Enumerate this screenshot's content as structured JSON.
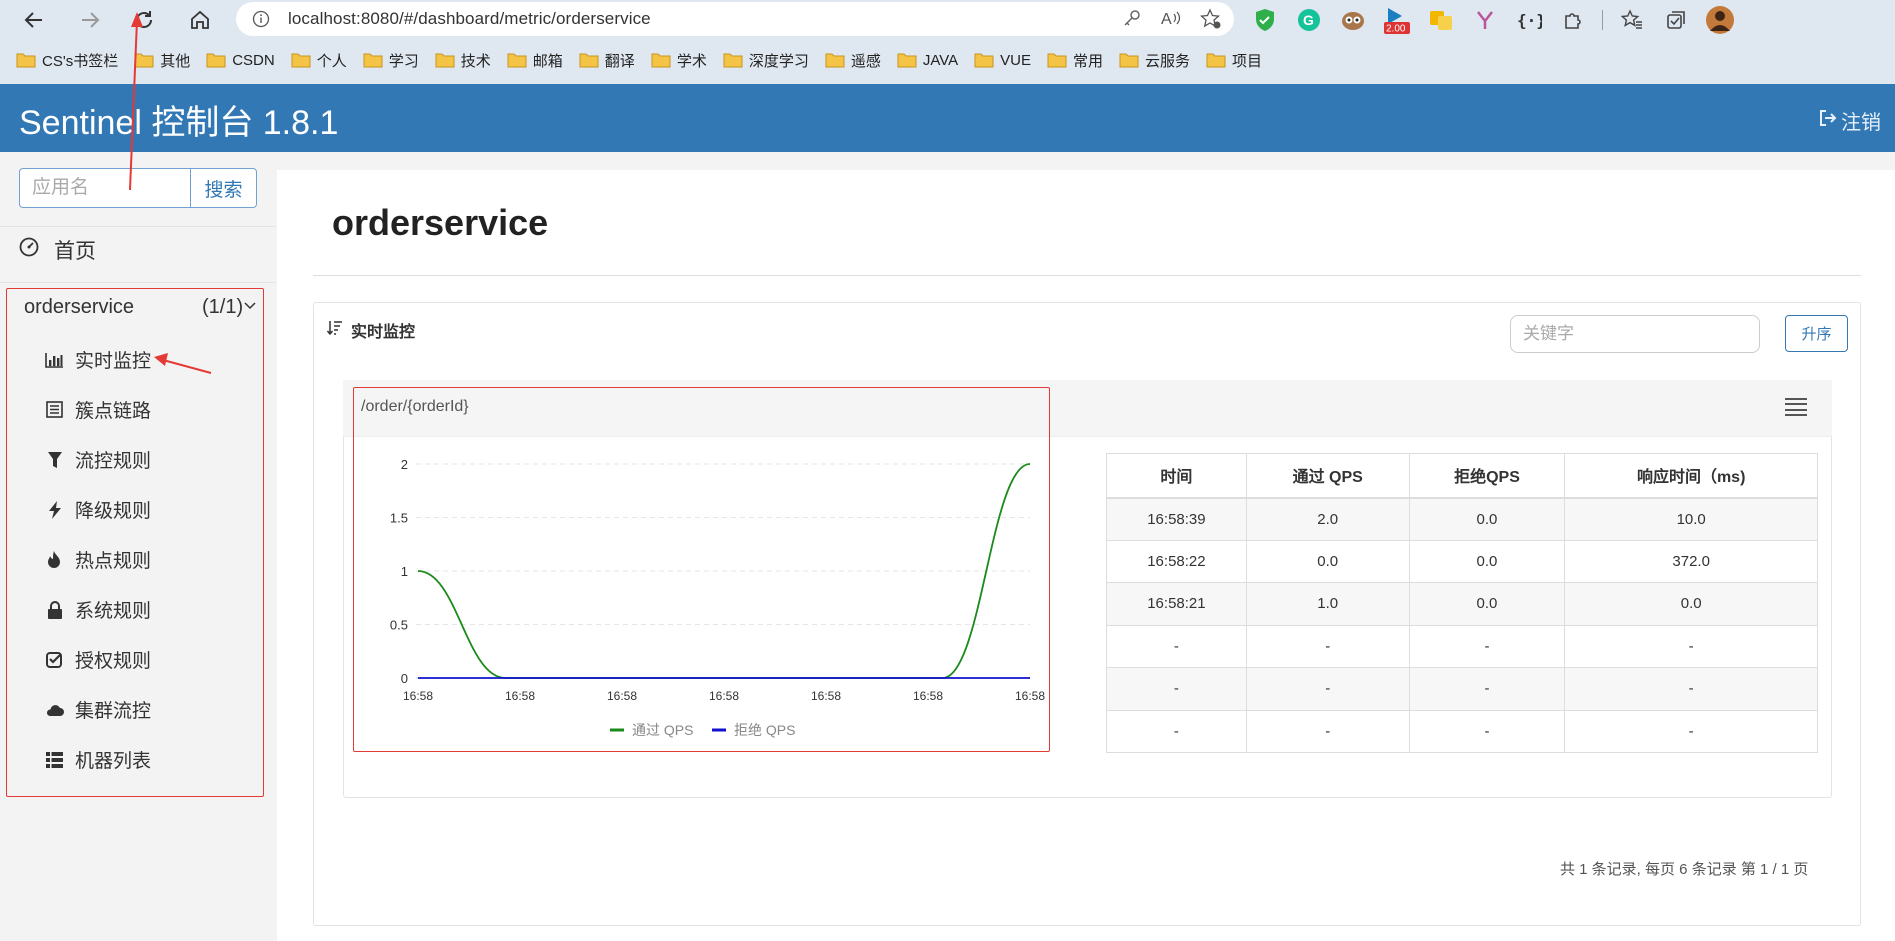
{
  "browser": {
    "url": "localhost:8080/#/dashboard/metric/orderservice",
    "zoom_badge": "2.00",
    "bookmarks": [
      "CS's书签栏",
      "其他",
      "CSDN",
      "个人",
      "学习",
      "技术",
      "邮箱",
      "翻译",
      "学术",
      "深度学习",
      "遥感",
      "JAVA",
      "VUE",
      "常用",
      "云服务",
      "项目"
    ]
  },
  "header": {
    "title": "Sentinel 控制台 1.8.1",
    "logout_label": "注销"
  },
  "sidebar": {
    "search_placeholder": "应用名",
    "search_button": "搜索",
    "home_label": "首页",
    "app_name": "orderservice",
    "app_count": "(1/1)",
    "menu": [
      {
        "label": "实时监控",
        "icon": "bar-chart-icon"
      },
      {
        "label": "簇点链路",
        "icon": "list-icon"
      },
      {
        "label": "流控规则",
        "icon": "filter-icon"
      },
      {
        "label": "降级规则",
        "icon": "bolt-icon"
      },
      {
        "label": "热点规则",
        "icon": "fire-icon"
      },
      {
        "label": "系统规则",
        "icon": "lock-icon"
      },
      {
        "label": "授权规则",
        "icon": "check-square-icon"
      },
      {
        "label": "集群流控",
        "icon": "cloud-icon"
      },
      {
        "label": "机器列表",
        "icon": "table-list-icon"
      }
    ]
  },
  "main": {
    "page_title": "orderservice",
    "panel_title": "实时监控",
    "keyword_placeholder": "关键字",
    "sort_button": "升序",
    "resource_name": "/order/{orderId}",
    "pager_text": "共 1 条记录, 每页 6 条记录 第 1 / 1 页"
  },
  "table": {
    "headers": [
      "时间",
      "通过 QPS",
      "拒绝QPS",
      "响应时间（ms)"
    ],
    "rows": [
      [
        "16:58:39",
        "2.0",
        "0.0",
        "10.0"
      ],
      [
        "16:58:22",
        "0.0",
        "0.0",
        "372.0"
      ],
      [
        "16:58:21",
        "1.0",
        "0.0",
        "0.0"
      ],
      [
        "-",
        "-",
        "-",
        "-"
      ],
      [
        "-",
        "-",
        "-",
        "-"
      ],
      [
        "-",
        "-",
        "-",
        "-"
      ]
    ]
  },
  "chart_data": {
    "type": "line",
    "x": [
      "16:58",
      "16:58",
      "16:58",
      "16:58",
      "16:58",
      "16:58",
      "16:58"
    ],
    "ylim": [
      0,
      2
    ],
    "yticks": [
      "0",
      "0.5",
      "1",
      "1.5",
      "2"
    ],
    "grid": true,
    "legend_position": "bottom",
    "series": [
      {
        "name": "通过 QPS",
        "color": "#1a8a1a",
        "values": [
          1,
          0,
          0,
          0,
          0,
          0,
          0,
          2
        ]
      },
      {
        "name": "拒绝 QPS",
        "color": "#1010d0",
        "values": [
          0,
          0,
          0,
          0,
          0,
          0,
          0,
          0
        ]
      }
    ]
  }
}
